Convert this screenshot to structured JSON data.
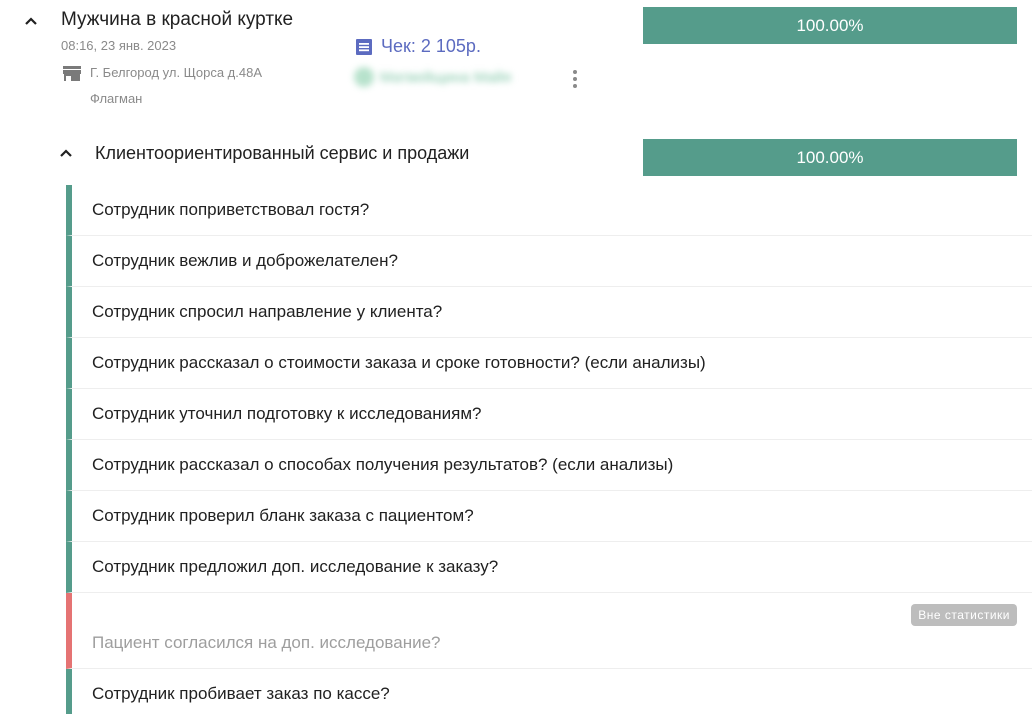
{
  "visit": {
    "title": "Мужчина в красной куртке",
    "datetime": "08:16, 23 янв. 2023",
    "store_address": "Г. Белгород ул. Щорса д.48А",
    "store_type": "Флагман",
    "receipt_label": "Чек: 2 105р.",
    "employee_name": "Матвейщина Майя",
    "score_text": "100.00%",
    "score": 1.0,
    "collapse_icon": "chevron-up-icon",
    "store_icon": "store-icon",
    "receipt_icon": "receipt-icon",
    "employee_icon": "person-icon"
  },
  "section": {
    "title": "Клиентоориентированный сервис и продажи",
    "score_text": "100.00%",
    "score": 1.0
  },
  "colors": {
    "accent": "#559c8b",
    "excluded": "#e57373",
    "link": "#5c6bc0",
    "badge_bg": "#bdbdbd"
  },
  "questions": [
    {
      "text": "Сотрудник поприветствовал гостя?",
      "status": "passed"
    },
    {
      "text": "Сотрудник вежлив и доброжелателен?",
      "status": "passed"
    },
    {
      "text": "Сотрудник спросил направление у клиента?",
      "status": "passed"
    },
    {
      "text": "Сотрудник рассказал о стоимости заказа и сроке готовности? (если анализы)",
      "status": "passed"
    },
    {
      "text": "Сотрудник уточнил подготовку к исследованиям?",
      "status": "passed"
    },
    {
      "text": "Сотрудник рассказал о способах получения результатов? (если анализы)",
      "status": "passed"
    },
    {
      "text": "Сотрудник проверил бланк заказа с пациентом?",
      "status": "passed"
    },
    {
      "text": "Сотрудник предложил доп. исследование к заказу?",
      "status": "passed"
    },
    {
      "text": "Пациент согласился на доп. исследование?",
      "status": "excluded",
      "badge": "Вне статистики"
    },
    {
      "text": "Сотрудник пробивает заказ по кассе?",
      "status": "passed"
    }
  ]
}
